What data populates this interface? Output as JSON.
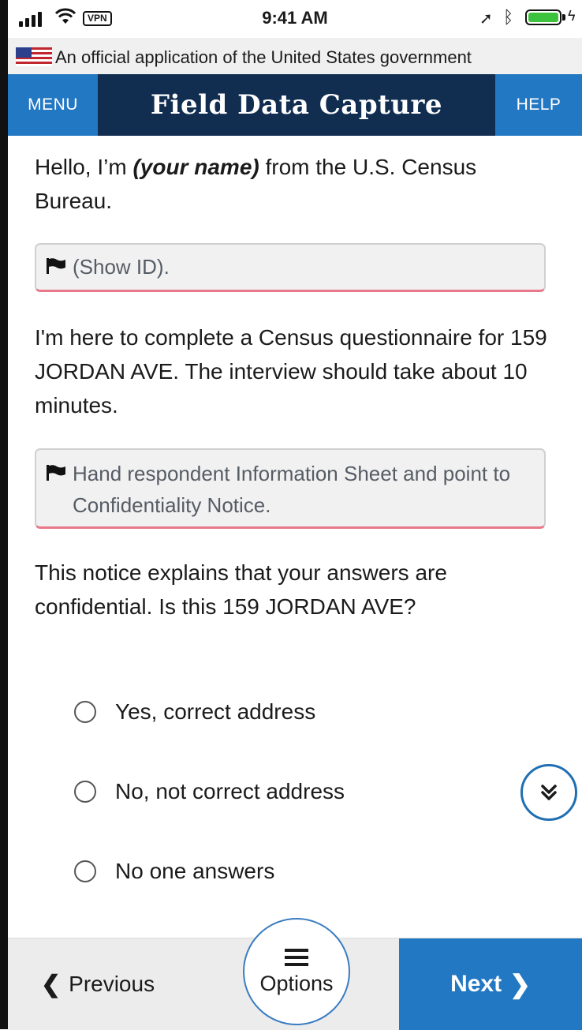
{
  "status_bar": {
    "vpn": "VPN",
    "time": "9:41 AM"
  },
  "gov_banner": {
    "text": "An official application of the United States government",
    "icon": "us-flag-icon"
  },
  "header": {
    "menu_label": "MENU",
    "title": "Field Data Capture",
    "help_label": "HELP",
    "color_dark": "#112e51",
    "color_accent": "#2378c3"
  },
  "content": {
    "greeting_prefix": "Hello, I’m ",
    "greeting_name": "(your name)",
    "greeting_suffix": " from the U.S. Census Bureau.",
    "instruction_1": "(Show ID).",
    "intro_text": "I'm here to complete a Census questionnaire for 159 JORDAN AVE. The interview should take about 10 minutes.",
    "instruction_2": "Hand respondent Information Sheet and point to Confidentiality Notice.",
    "question": "This notice explains that your answers are confidential. Is this 159 JORDAN AVE?",
    "options": [
      {
        "label": "Yes, correct address",
        "selected": false
      },
      {
        "label": "No, not correct address",
        "selected": false
      },
      {
        "label": "No one answers",
        "selected": false
      }
    ]
  },
  "footer": {
    "previous_label": "Previous",
    "options_label": "Options",
    "next_label": "Next"
  }
}
